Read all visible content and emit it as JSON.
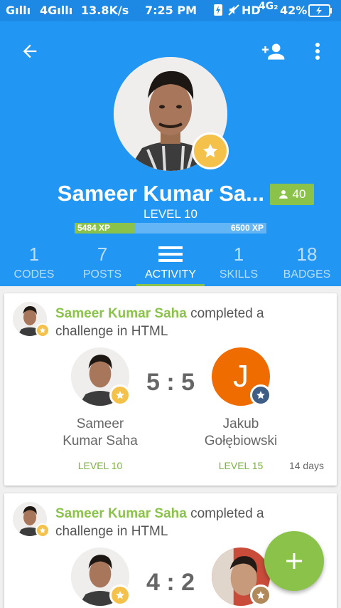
{
  "status_bar": {
    "carrier_1": "Gıllı",
    "carrier_2": "4Gıllı",
    "speed": "13.8K/s",
    "time": "7:25 PM",
    "network": "HD",
    "network_type": "4G₂",
    "battery": "42%"
  },
  "profile": {
    "name": "Sameer Kumar Sa...",
    "followers": "40",
    "level": "LEVEL 10",
    "xp_current": "5484 XP",
    "xp_next": "6500 XP",
    "xp_progress": 0.31
  },
  "tabs": [
    {
      "count": "1",
      "label": "CODES"
    },
    {
      "count": "7",
      "label": "POSTS"
    },
    {
      "count": "",
      "label": "ACTIVITY",
      "active": true
    },
    {
      "count": "1",
      "label": "SKILLS"
    },
    {
      "count": "18",
      "label": "BADGES"
    }
  ],
  "feed": [
    {
      "actor": "Sameer Kumar Saha",
      "action": "completed a challenge in HTML",
      "score": "5 : 5",
      "player1": {
        "name": "Sameer Kumar Saha",
        "level": "LEVEL 10"
      },
      "player2": {
        "name": "Jakub Gołębiowski",
        "level": "LEVEL 15",
        "initial": "J"
      },
      "time": "14 days"
    },
    {
      "actor": "Sameer Kumar Saha",
      "action": "completed a challenge in HTML",
      "score": "4 : 2"
    }
  ],
  "colors": {
    "primary": "#2196f3",
    "status_bar": "#1e88e5",
    "accent": "#8bc34a",
    "star": "#f4c24b",
    "opponent_avatar": "#ef6c00"
  }
}
